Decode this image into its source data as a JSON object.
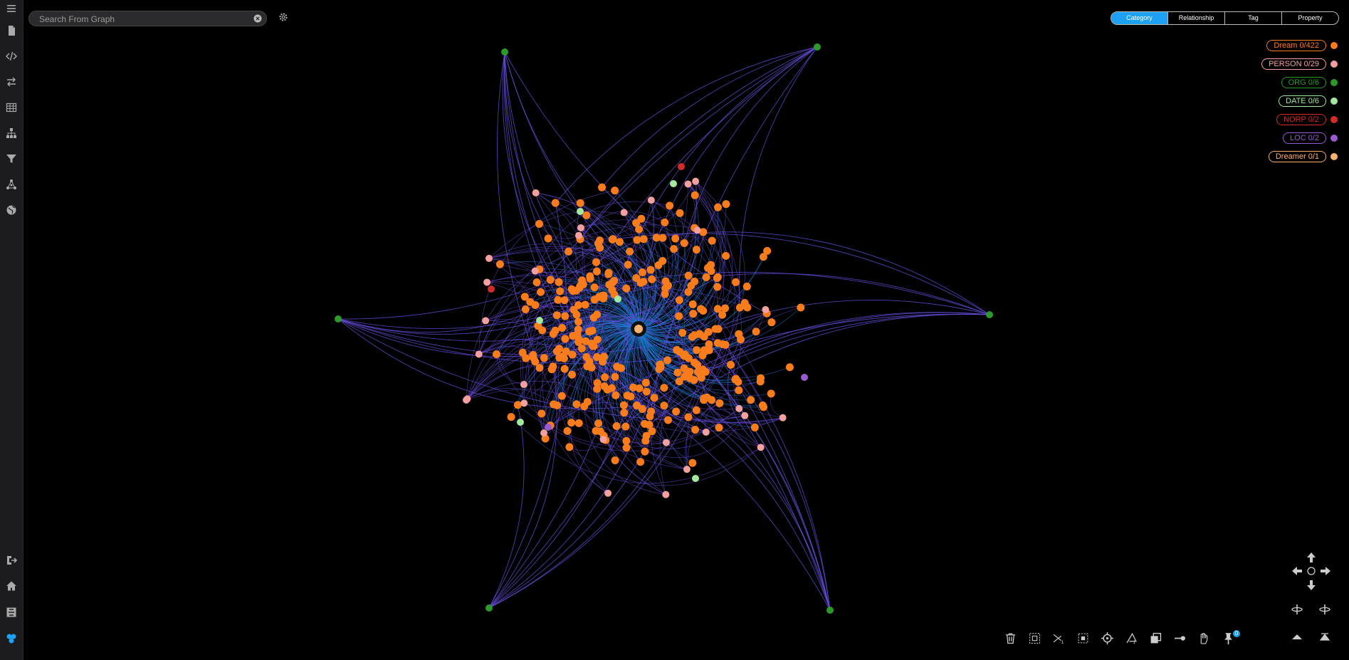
{
  "search": {
    "placeholder": "Search From Graph",
    "value": ""
  },
  "sidebar": {
    "items": [
      {
        "icon": "menu-icon"
      },
      {
        "icon": "document-icon"
      },
      {
        "icon": "code-icon"
      },
      {
        "icon": "transfer-icon"
      },
      {
        "icon": "table-icon"
      },
      {
        "icon": "hierarchy-icon"
      },
      {
        "icon": "filter-icon"
      },
      {
        "icon": "network-icon"
      },
      {
        "icon": "globe-icon"
      }
    ],
    "bottom_items": [
      {
        "icon": "logout-icon"
      },
      {
        "icon": "home-icon"
      },
      {
        "icon": "puzzle-icon"
      },
      {
        "icon": "app-logo-icon"
      }
    ]
  },
  "tabs": [
    {
      "label": "Category",
      "active": true
    },
    {
      "label": "Relationship",
      "active": false
    },
    {
      "label": "Tag",
      "active": false
    },
    {
      "label": "Property",
      "active": false
    }
  ],
  "legend": [
    {
      "label": "Dream 0/422",
      "color": "#f97c1c"
    },
    {
      "label": "PERSON 0/29",
      "color": "#f4a0a0"
    },
    {
      "label": "ORG 0/6",
      "color": "#2a9a2a"
    },
    {
      "label": "DATE 0/6",
      "color": "#a4e8a0"
    },
    {
      "label": "NORP 0/2",
      "color": "#d42a2a"
    },
    {
      "label": "LOC 0/2",
      "color": "#9a5ad2"
    },
    {
      "label": "Dreamer 0/1",
      "color": "#f7b070"
    }
  ],
  "colors": {
    "edge_primary": "#1c7ed6",
    "edge_secondary": "#6a4fe0",
    "active_tab": "#1ea1f2"
  },
  "toolbar": {
    "items": [
      {
        "icon": "trash-icon"
      },
      {
        "icon": "select-box-icon"
      },
      {
        "icon": "scissors-icon"
      },
      {
        "icon": "crop-icon"
      },
      {
        "icon": "target-icon"
      },
      {
        "icon": "lasso-icon"
      },
      {
        "icon": "layers-icon"
      },
      {
        "icon": "connect-icon"
      },
      {
        "icon": "hand-icon"
      },
      {
        "icon": "pin-icon"
      }
    ],
    "pin_count": "0"
  },
  "nav_controls": [
    {
      "icon": "arrow-up-icon"
    },
    {
      "icon": "arrow-left-icon"
    },
    {
      "icon": "center-icon"
    },
    {
      "icon": "arrow-right-icon"
    },
    {
      "icon": "arrow-down-icon"
    },
    {
      "icon": "rotate-left-icon"
    },
    {
      "icon": "rotate-right-icon"
    },
    {
      "icon": "tilt-up-icon"
    },
    {
      "icon": "tilt-down-icon"
    }
  ]
}
